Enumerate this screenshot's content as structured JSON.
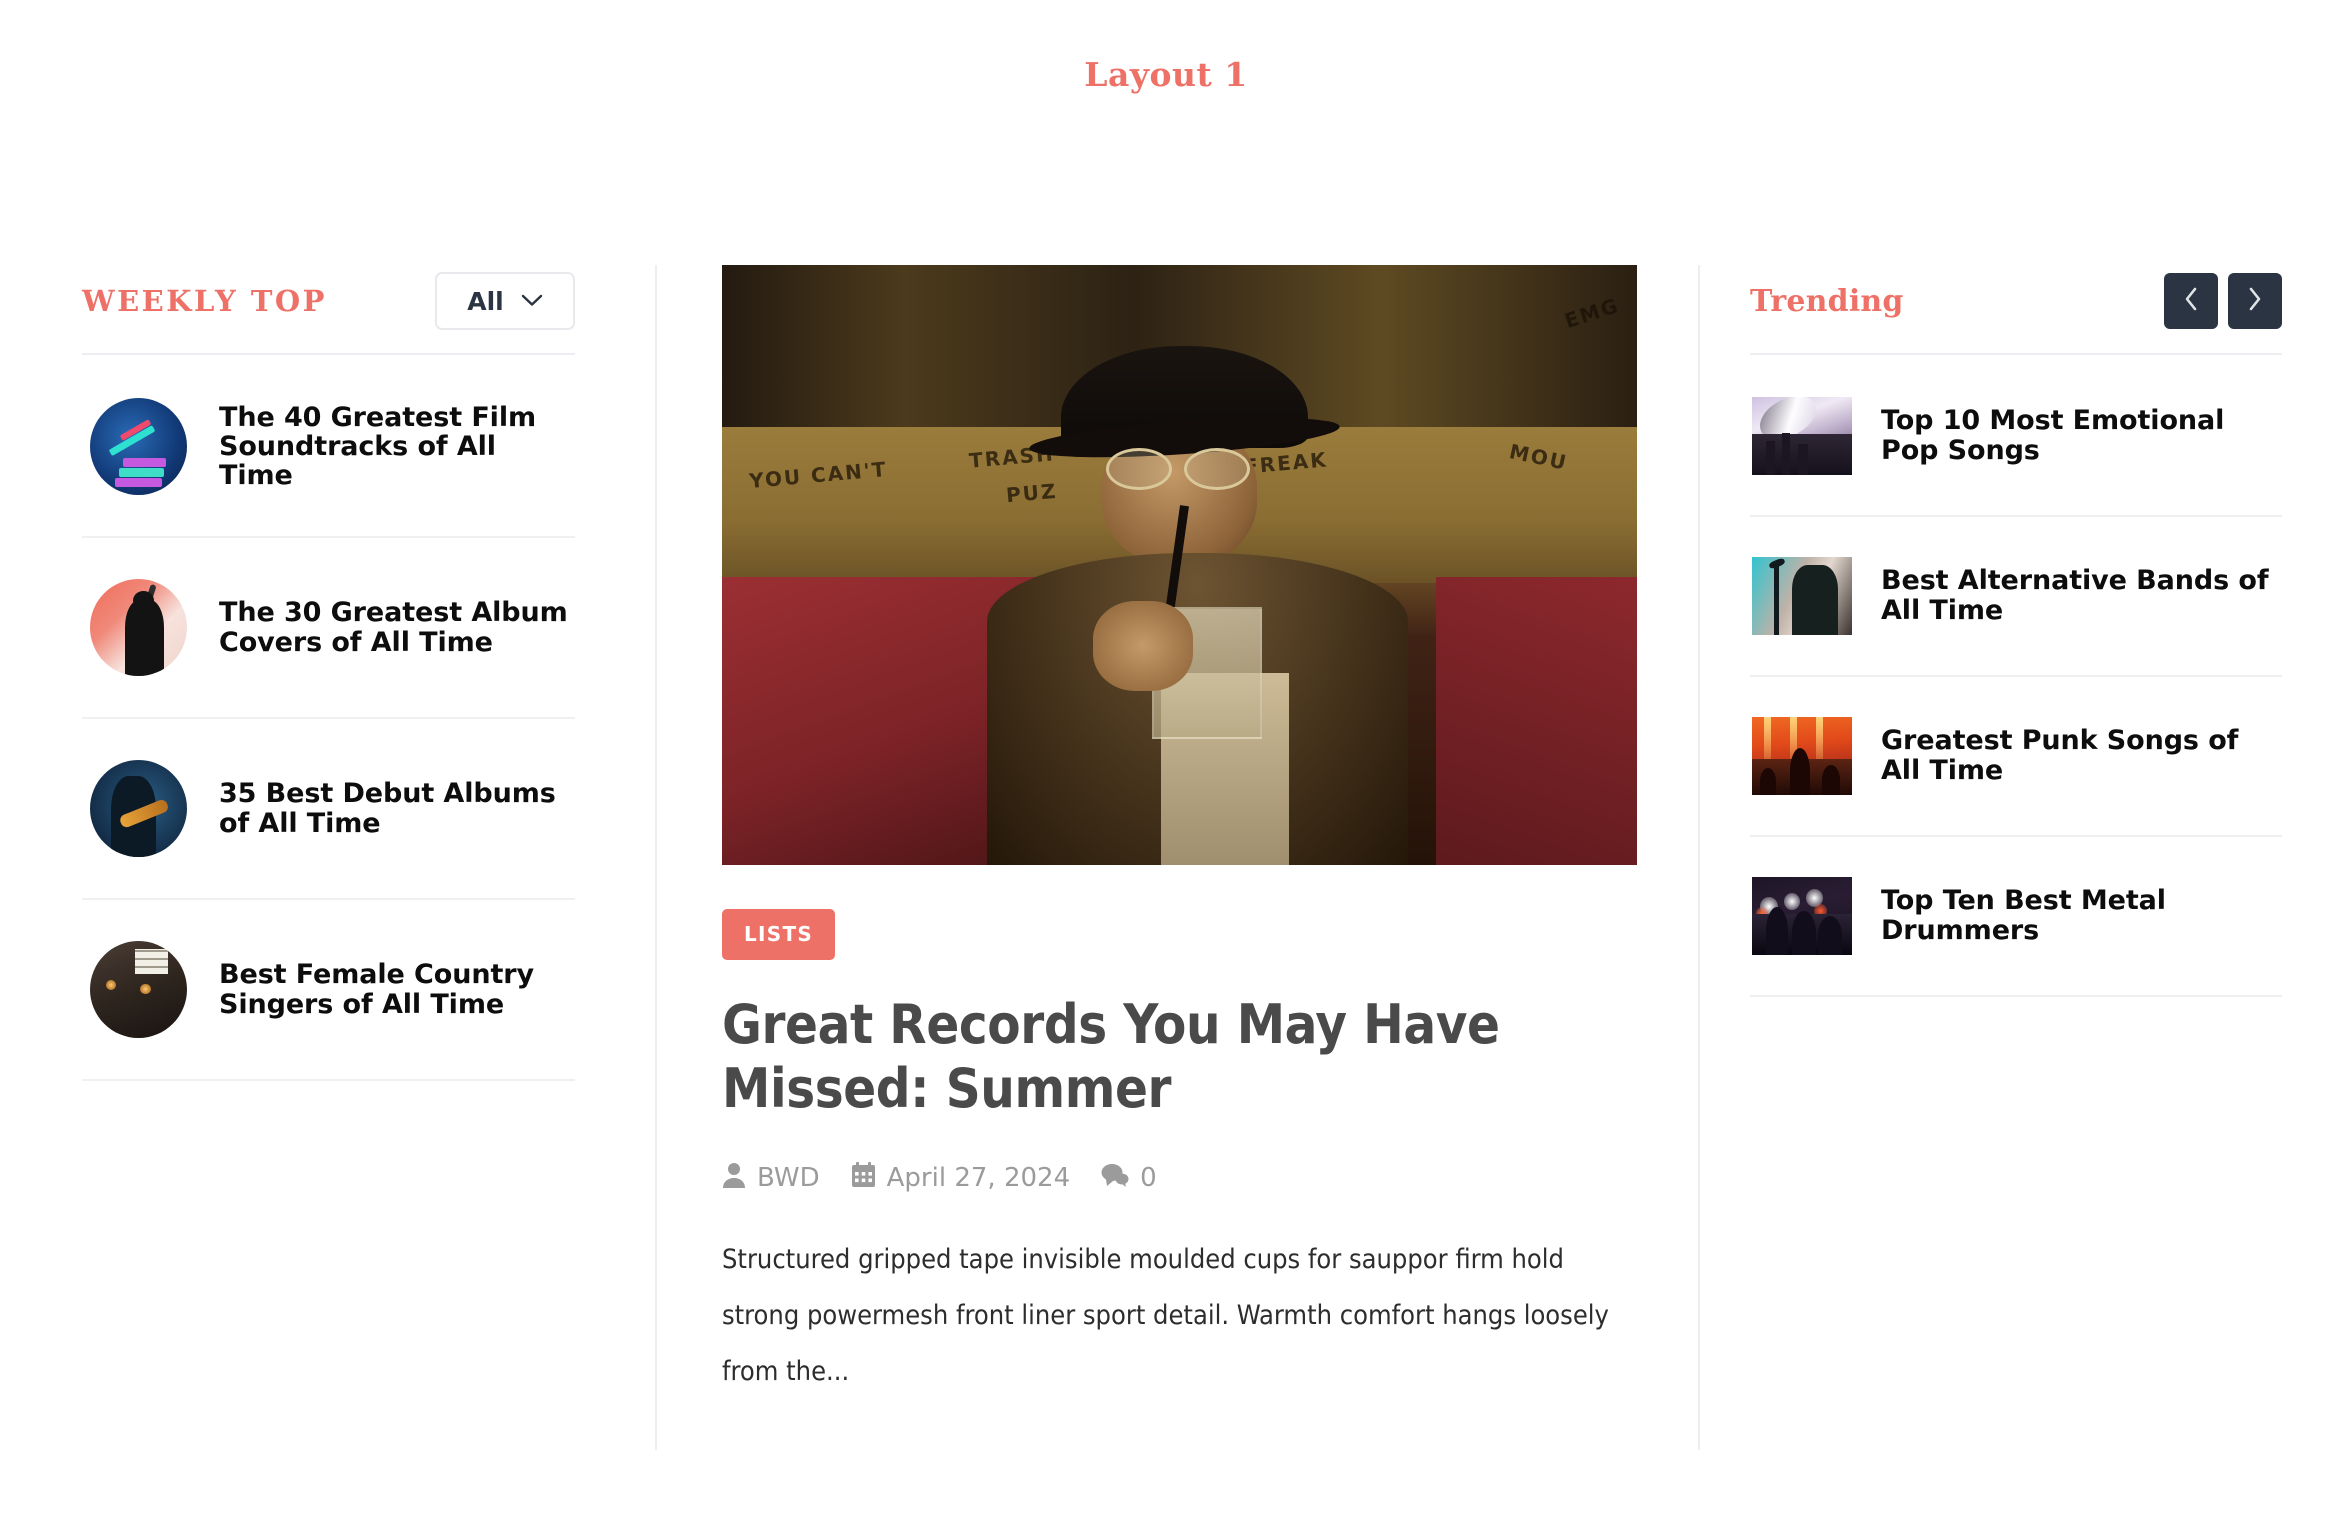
{
  "page": {
    "title": "Layout 1"
  },
  "weekly": {
    "heading": "WEEKLY TOP",
    "filter": {
      "value": "All",
      "icon": "chevron-down-icon"
    },
    "items": [
      {
        "title": "The 40 Greatest Film Soundtracks of All Time",
        "thumb": "audio-mixer-blue"
      },
      {
        "title": "The 30 Greatest Album Covers of All Time",
        "thumb": "singer-red-backdrop"
      },
      {
        "title": "35 Best Debut Albums of All Time",
        "thumb": "guitarist-blue-stage"
      },
      {
        "title": "Best Female Country Singers of All Time",
        "thumb": "dark-studio-window"
      }
    ]
  },
  "featured": {
    "image_alt": "man-in-fedora-drinking-through-straw",
    "category": "LISTS",
    "headline": "Great Records You May Have Missed: Summer",
    "meta": {
      "author_icon": "user-icon",
      "author": "BWD",
      "date_icon": "calendar-icon",
      "date": "April 27, 2024",
      "comments_icon": "comments-icon",
      "comments": "0"
    },
    "excerpt": "Structured gripped tape invisible moulded cups for sauppor firm hold strong powermesh front liner sport detail. Warmth comfort hangs loosely from the..."
  },
  "trending": {
    "heading": "Trending",
    "prev_icon": "chevron-left-icon",
    "next_icon": "chevron-right-icon",
    "items": [
      {
        "title": "Top 10 Most Emotional Pop Songs",
        "thumb": "crowd-smoke"
      },
      {
        "title": "Best Alternative Bands of All Time",
        "thumb": "singer-teal-spotlight"
      },
      {
        "title": "Greatest Punk Songs of All Time",
        "thumb": "orange-concert-crowd"
      },
      {
        "title": "Top Ten Best Metal Drummers",
        "thumb": "dark-club-lights"
      }
    ]
  },
  "colors": {
    "accent": "#ee7168",
    "nav_button": "#2b3443",
    "headline": "#4a4a4a",
    "meta_text": "#9b9b9b",
    "divider": "#eceef1"
  }
}
